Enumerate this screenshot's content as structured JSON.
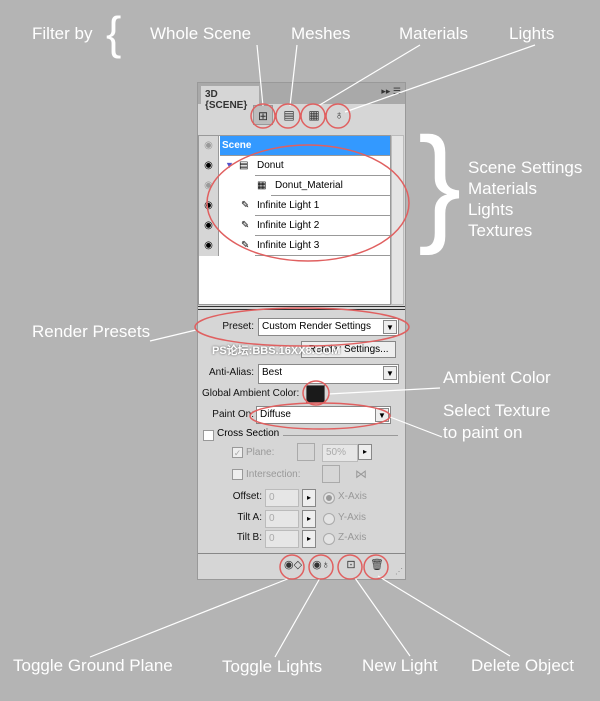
{
  "annotations": {
    "filter_by": "Filter by",
    "whole_scene": "Whole Scene",
    "meshes": "Meshes",
    "materials": "Materials",
    "lights": "Lights",
    "scene_settings": "Scene Settings",
    "materials_r": "Materials",
    "lights_r": "Lights",
    "textures": "Textures",
    "render_presets": "Render Presets",
    "ambient_color": "Ambient Color",
    "select_texture_1": "Select Texture",
    "select_texture_2": "to paint on",
    "toggle_ground_plane": "Toggle Ground Plane",
    "toggle_lights": "Toggle Lights",
    "new_light": "New Light",
    "delete_object": "Delete Object"
  },
  "panel": {
    "tab": "3D {SCENE}",
    "menu_icon": "panel-menu-icon",
    "tree": [
      {
        "label": "Scene",
        "selected": true,
        "icon": ""
      },
      {
        "label": "Donut",
        "icon": "mesh-icon"
      },
      {
        "label": "Donut_Material",
        "icon": "material-icon"
      },
      {
        "label": "Infinite Light 1",
        "icon": "light-icon"
      },
      {
        "label": "Infinite Light 2",
        "icon": "light-icon"
      },
      {
        "label": "Infinite Light 3",
        "icon": "light-icon"
      }
    ],
    "preset_label": "Preset:",
    "preset_value": "Custom Render Settings",
    "render_settings_button": "Render Settings...",
    "watermark": "PS论坛:BBS.16XX8.COM",
    "anti_alias_label": "Anti-Alias:",
    "anti_alias_value": "Best",
    "ambient_label": "Global Ambient Color:",
    "ambient_color": "#1a1a1a",
    "paint_on_label": "Paint On:",
    "paint_on_value": "Diffuse",
    "cross_section": "Cross Section",
    "plane_label": "Plane:",
    "plane_value": "50%",
    "intersection_label": "Intersection:",
    "offset_label": "Offset:",
    "offset_value": "0",
    "tilt_a_label": "Tilt A:",
    "tilt_a_value": "0",
    "tilt_b_label": "Tilt B:",
    "tilt_b_value": "0",
    "x_axis": "X-Axis",
    "y_axis": "Y-Axis",
    "z_axis": "Z-Axis"
  },
  "colors": {
    "selection": "#3399ff",
    "highlight": "#e06060",
    "background": "#b4b4b4"
  }
}
